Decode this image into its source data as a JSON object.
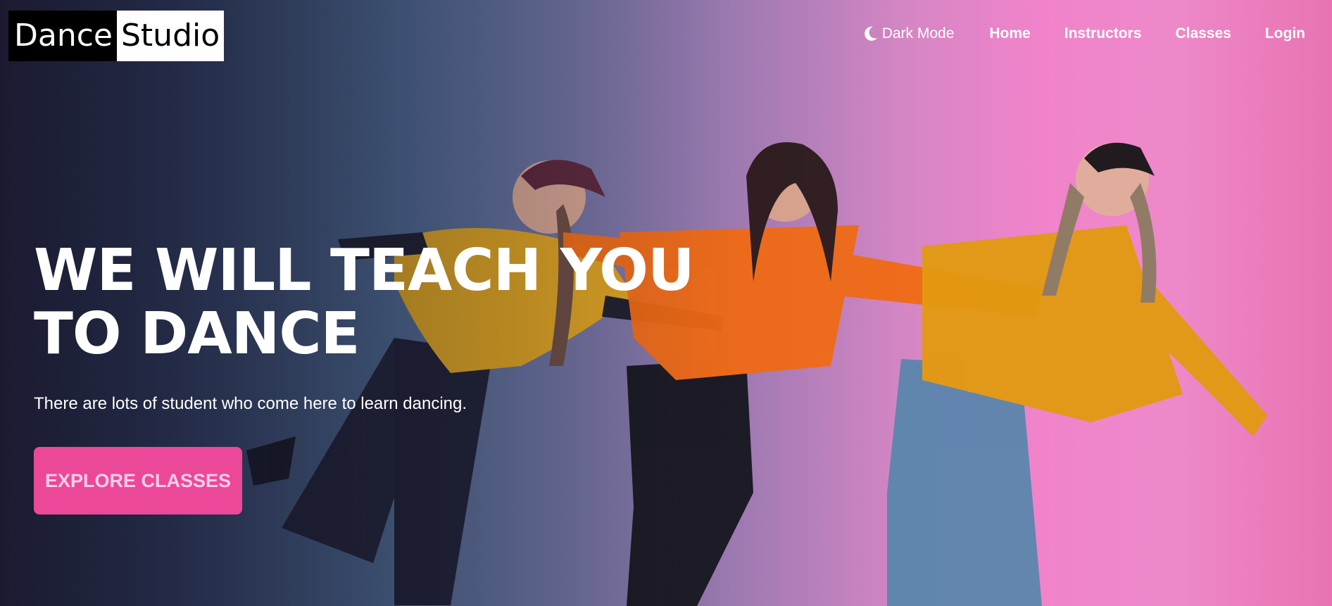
{
  "logo": {
    "part1": "Dance",
    "part2": "Studio"
  },
  "nav": {
    "dark_mode_label": "Dark Mode",
    "links": [
      "Home",
      "Instructors",
      "Classes",
      "Login"
    ]
  },
  "hero": {
    "headline": "WE WILL TEACH YOU TO DANCE",
    "subtitle": "There are lots of student who come here to learn dancing.",
    "cta_label": "EXPLORE CLASSES"
  },
  "icons": {
    "dark_mode": "moon-icon"
  },
  "colors": {
    "accent": "#ec4899",
    "cta_text": "#fbcfe8"
  }
}
